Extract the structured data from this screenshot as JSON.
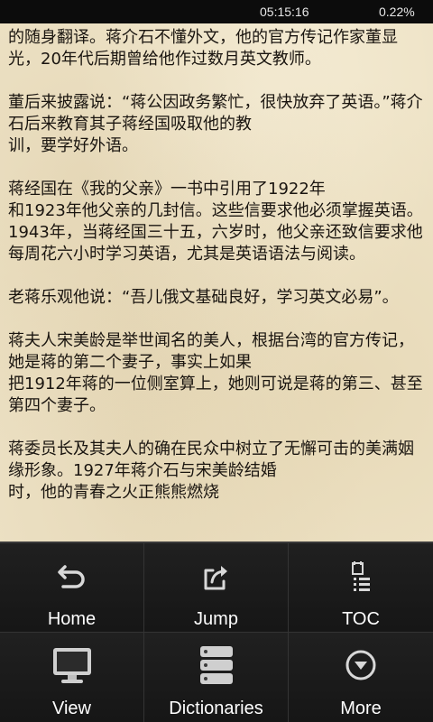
{
  "status_bar": {
    "time": "05:15:16",
    "battery": "0.22%"
  },
  "reader": {
    "paragraphs": [
      "的随身翻译。蒋介石不懂外文，他的官方传记作家董显光，20年代后期曾给他作过数月英文教师。",
      "董后来披露说：“蒋公因政务繁忙，很快放弃了英语。”蒋介石后来教育其子蒋经国吸取他的教\n训，要学好外语。",
      "蒋经国在《我的父亲》一书中引用了1922年\n和1923年他父亲的几封信。这些信要求他必须掌握英语。1943年，当蒋经国三十五，六岁时，他父亲还致信要求他每周花六小时学习英语，尤其是英语语法与阅读。",
      "老蒋乐观他说：“吾儿俄文基础良好，学习英文必易”。",
      "蒋夫人宋美龄是举世闻名的美人，根据台湾的官方传记，她是蒋的第二个妻子，事实上如果\n把1912年蒋的一位侧室算上，她则可说是蒋的第三、甚至第四个妻子。",
      "蒋委员长及其夫人的确在民众中树立了无懈可击的美满姻缘形象。1927年蒋介石与宋美龄结婚\n时，他的青春之火正熊熊燃烧"
    ]
  },
  "menu": {
    "items": [
      {
        "label": "Home",
        "icon": "back-arrow-icon"
      },
      {
        "label": "Jump",
        "icon": "jump-share-icon"
      },
      {
        "label": "TOC",
        "icon": "toc-list-icon"
      },
      {
        "label": "View",
        "icon": "monitor-icon"
      },
      {
        "label": "Dictionaries",
        "icon": "dictionaries-stack-icon"
      },
      {
        "label": "More",
        "icon": "chevron-down-circle-icon"
      }
    ]
  }
}
